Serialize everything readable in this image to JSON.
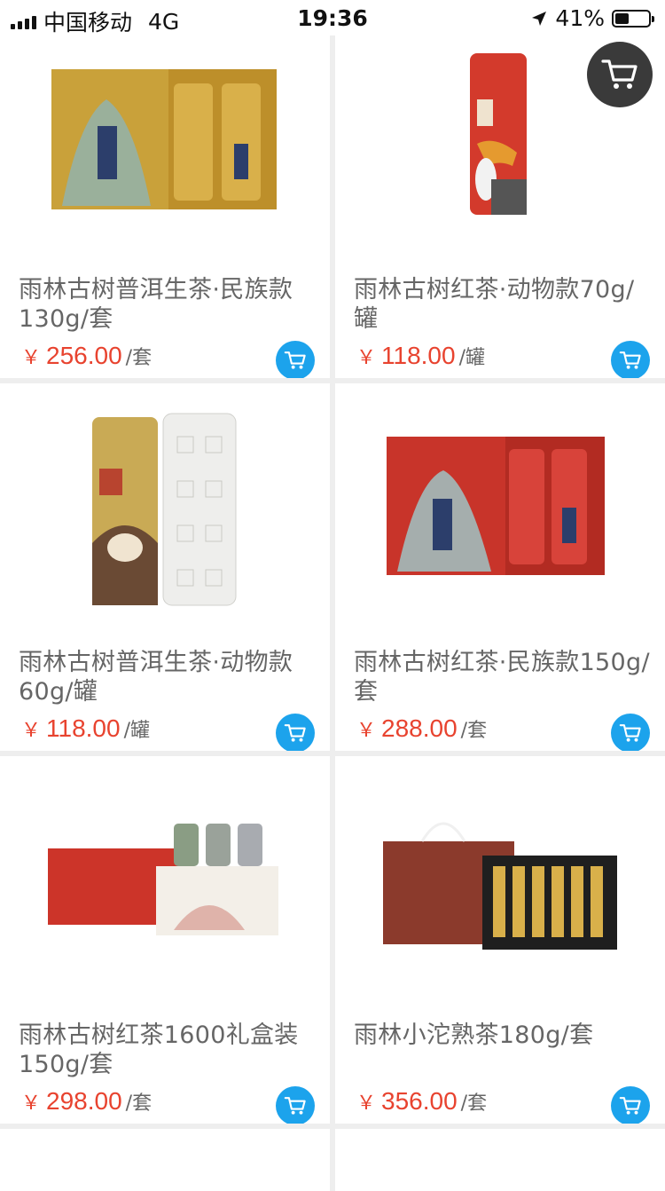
{
  "status_bar": {
    "carrier": "中国移动",
    "network": "4G",
    "time": "19:36",
    "battery": "41%",
    "battery_level": 0.41
  },
  "floating_cart": {
    "icon": "cart-icon"
  },
  "products": [
    {
      "title": "雨林古树普洱生茶·民族款130g/套",
      "currency": "￥",
      "price": "256.00",
      "unit": "/套"
    },
    {
      "title": "雨林古树红茶·动物款70g/罐",
      "currency": "￥",
      "price": "118.00",
      "unit": "/罐"
    },
    {
      "title": "雨林古树普洱生茶·动物款60g/罐",
      "currency": "￥",
      "price": "118.00",
      "unit": "/罐"
    },
    {
      "title": "雨林古树红茶·民族款150g/套",
      "currency": "￥",
      "price": "288.00",
      "unit": "/套"
    },
    {
      "title": "雨林古树红茶1600礼盒装150g/套",
      "currency": "￥",
      "price": "298.00",
      "unit": "/套"
    },
    {
      "title": "雨林小沱熟茶180g/套",
      "currency": "￥",
      "price": "356.00",
      "unit": "/套"
    }
  ],
  "colors": {
    "price": "#e8432f",
    "cart_button": "#1ca3ec",
    "floating_cart": "#3a3a3a",
    "background": "#eeeeee"
  }
}
